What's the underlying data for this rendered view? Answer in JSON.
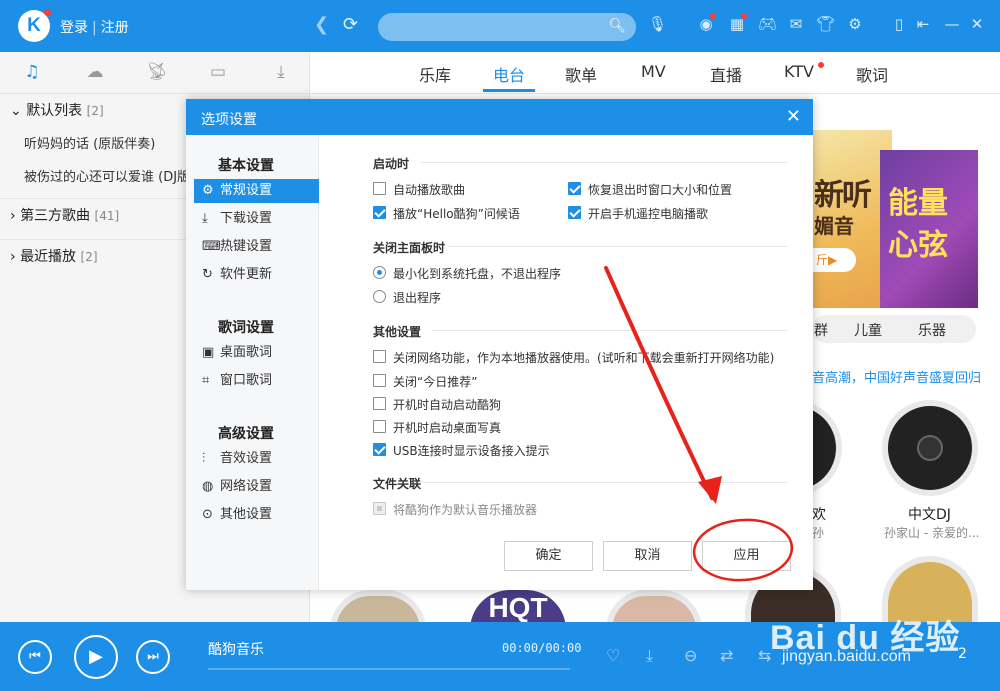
{
  "topbar": {
    "logo": "K",
    "login": "登录",
    "register": "注册",
    "search_placeholder": ""
  },
  "sidebar": {
    "lists": [
      {
        "name": "默认列表",
        "count": "[2]",
        "expanded": true,
        "songs": [
          "听妈妈的话 (原版伴奏)",
          "被伤过的心还可以爱谁 (DJ版"
        ]
      },
      {
        "name": "第三方歌曲",
        "count": "[41]",
        "expanded": false,
        "songs": []
      },
      {
        "name": "最近播放",
        "count": "[2]",
        "expanded": false,
        "songs": []
      }
    ]
  },
  "main": {
    "tabs": [
      "乐库",
      "电台",
      "歌单",
      "MV",
      "直播",
      "KTV",
      "歌词"
    ],
    "active_tab": "电台",
    "banner_a": {
      "line1": "新听",
      "line2": "媚音",
      "pill": "斤▶"
    },
    "banner_b": {
      "line1": "能量",
      "line2": "心弦"
    },
    "categories": [
      "群",
      "儿童",
      "乐器"
    ],
    "promo": "音高潮，中国好声音盛夏回归",
    "cards": [
      {
        "title": "欢",
        "sub": "孙"
      },
      {
        "title": "中文DJ",
        "sub": "孙家山 - 亲爱的..."
      }
    ],
    "hqt": "HQT"
  },
  "modal": {
    "title": "选项设置",
    "nav": {
      "groups": [
        {
          "label": "基本设置",
          "items": [
            {
              "label": "常规设置",
              "icon": "gear-icon",
              "active": true
            },
            {
              "label": "下载设置",
              "icon": "download-icon",
              "active": false
            },
            {
              "label": "热键设置",
              "icon": "keyboard-icon",
              "active": false
            },
            {
              "label": "软件更新",
              "icon": "update-icon",
              "active": false
            }
          ]
        },
        {
          "label": "歌词设置",
          "items": [
            {
              "label": "桌面歌词",
              "icon": "desktop-lyrics-icon",
              "active": false
            },
            {
              "label": "窗口歌词",
              "icon": "window-lyrics-icon",
              "active": false
            }
          ]
        },
        {
          "label": "高级设置",
          "items": [
            {
              "label": "音效设置",
              "icon": "equalizer-icon",
              "active": false
            },
            {
              "label": "网络设置",
              "icon": "network-icon",
              "active": false
            },
            {
              "label": "其他设置",
              "icon": "more-icon",
              "active": false
            }
          ]
        }
      ]
    },
    "sections": {
      "startup": {
        "title": "启动时",
        "options": [
          {
            "label": "自动播放歌曲",
            "checked": false
          },
          {
            "label": "恢复退出时窗口大小和位置",
            "checked": true
          },
          {
            "label": "播放“Hello酷狗”问候语",
            "checked": true
          },
          {
            "label": "开启手机遥控电脑播歌",
            "checked": true
          }
        ]
      },
      "close_panel": {
        "title": "关闭主面板时",
        "options": [
          {
            "label": "最小化到系统托盘，不退出程序",
            "selected": true
          },
          {
            "label": "退出程序",
            "selected": false
          }
        ]
      },
      "other": {
        "title": "其他设置",
        "options": [
          {
            "label": "关闭网络功能，作为本地播放器使用。(试听和下载会重新打开网络功能)",
            "checked": false
          },
          {
            "label": "关闭“今日推荐”",
            "checked": false
          },
          {
            "label": "开机时自动启动酷狗",
            "checked": false
          },
          {
            "label": "开机时启动桌面写真",
            "checked": false
          },
          {
            "label": "USB连接时显示设备接入提示",
            "checked": true
          }
        ]
      },
      "file_assoc": {
        "title": "文件关联",
        "options": [
          {
            "label": "将酷狗作为默认音乐播放器",
            "disabled": true
          }
        ]
      }
    },
    "buttons": {
      "ok": "确定",
      "cancel": "取消",
      "apply": "应用"
    }
  },
  "annotation": {
    "color": "#e8221b"
  },
  "player": {
    "title": "酷狗音乐",
    "time": "00:00/00:00",
    "count": "2"
  },
  "watermark": {
    "brand": "Bai du 经验",
    "url": "jingyan.baidu.com"
  },
  "colors": {
    "brand": "#1e8fe6",
    "annotation": "#e8221b"
  }
}
